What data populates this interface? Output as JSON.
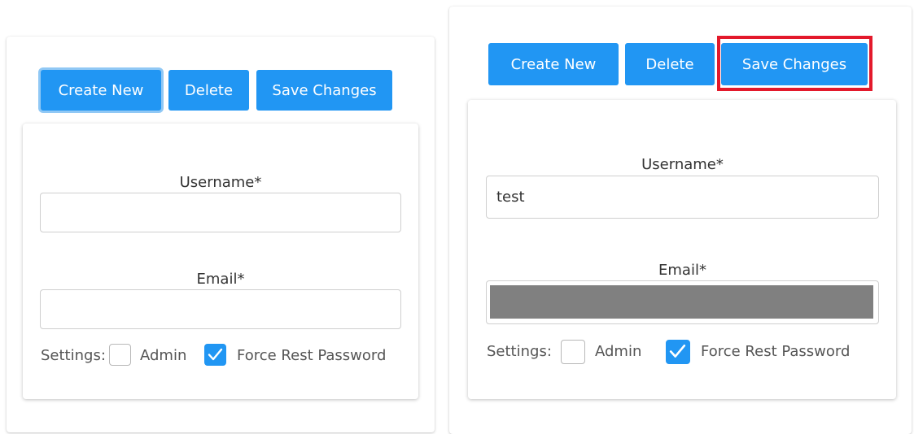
{
  "forms": [
    {
      "buttons": {
        "create": "Create New",
        "delete": "Delete",
        "save": "Save Changes"
      },
      "username": {
        "label": "Username*",
        "value": ""
      },
      "email": {
        "label": "Email*",
        "value": ""
      },
      "settings": {
        "label": "Settings:",
        "admin": "Admin",
        "admin_checked": false,
        "force_reset": "Force Rest Password",
        "force_reset_checked": true
      }
    },
    {
      "buttons": {
        "create": "Create New",
        "delete": "Delete",
        "save": "Save Changes"
      },
      "username": {
        "label": "Username*",
        "value": "test"
      },
      "email": {
        "label": "Email*",
        "value": ""
      },
      "settings": {
        "label": "Settings:",
        "admin": "Admin",
        "admin_checked": false,
        "force_reset": "Force Rest Password",
        "force_reset_checked": true
      }
    }
  ],
  "colors": {
    "primary": "#2196f3",
    "highlight": "#e3192b",
    "redaction": "#808080"
  }
}
